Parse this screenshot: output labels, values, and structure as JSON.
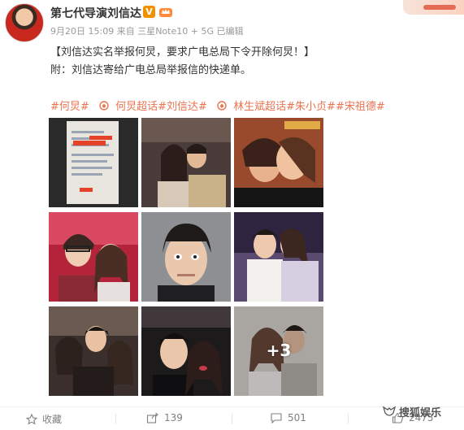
{
  "author": {
    "name": "第七代导演刘信达",
    "verified_badge": "V",
    "time": "9月20日 15:09",
    "source": "来自 三星Note10 + 5G",
    "edited": "已编辑"
  },
  "post": {
    "line1": "【刘信达实名举报何炅，要求广电总局下令开除何炅！】",
    "line2": "附：刘信达寄给广电总局举报信的快递单。"
  },
  "tags": {
    "tag1": "#何炅#",
    "tag2": "何炅超话#刘信达#",
    "tag3": "林生斌超话#朱小贞##宋祖德#"
  },
  "gallery": {
    "more_label": "+3"
  },
  "actions": {
    "favorite": "收藏",
    "share_count": "139",
    "comment_count": "501",
    "like_count": "2475"
  },
  "watermark": "搜狐娱乐",
  "colors": {
    "link": "#eb7350",
    "meta": "#999999",
    "verified": "#f29100"
  }
}
